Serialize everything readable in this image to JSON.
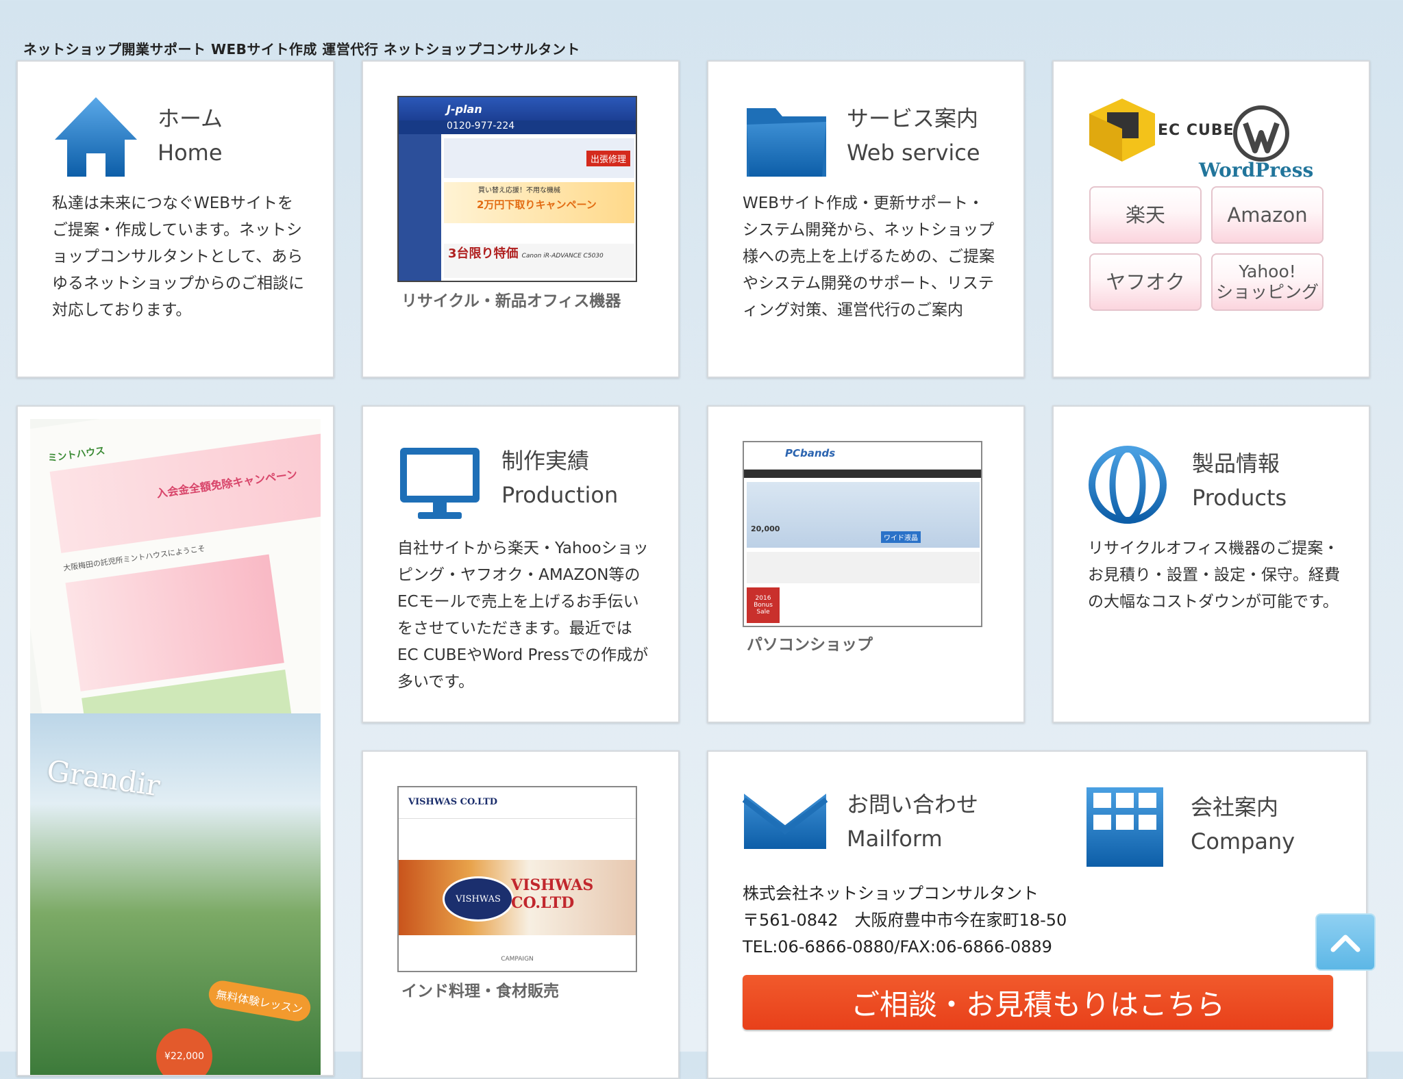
{
  "site_title": "ネットショップ開業サポート WEBサイト作成 運営代行 ネットショップコンサルタント",
  "home": {
    "title_ja": "ホーム",
    "title_en": "Home",
    "description": "私達は未来につなぐWEBサイトをご提案・作成しています。ネットショップコンサルタントとして、あらゆるネットショップからのご相談に対応しております。"
  },
  "recycle": {
    "caption": "リサイクル・新品オフィス機器",
    "shot_logo": "J-plan",
    "shot_phone": "0120-977-224",
    "shot_banner": "出張修理",
    "shot_sale": "2万円下取りキャンペーン",
    "shot_sub": "買い替え応援！不用な機械",
    "shot_deal": "3台限り特価",
    "shot_brand": "Canon iR-ADVANCE C5030"
  },
  "service": {
    "title_ja": "サービス案内",
    "title_en": "Web service",
    "description": "WEBサイト作成・更新サポート・システム開発から、ネットショップ様への売上を上げるための、ご提案やシステム開発のサポート、リスティング対策、運営代行のご案内"
  },
  "malls": {
    "eccube_label": "EC CUBE",
    "wordpress_label": "WordPress",
    "buttons": [
      "楽天",
      "Amazon",
      "ヤフオク",
      "Yahoo!\nショッピング"
    ]
  },
  "mint": {
    "brand": "ミントハウス",
    "welcome": "大阪梅田の託児所ミントハウスにようこそ",
    "campaign": "入会金全額免除キャンペーン",
    "grandir": "Grandir",
    "lesson": "無料体験レッスン",
    "price": "¥22,000"
  },
  "production": {
    "title_ja": "制作実績",
    "title_en": "Production",
    "description": "自社サイトから楽天・Yahooショッピング・ヤフオク・AMAZON等のECモールで売上を上げるお手伝いをさせていただきます。最近ではEC CUBEやWord Pressでの作成が多いです。"
  },
  "pcshop": {
    "caption": "パソコンショップ",
    "shot_logo": "PCbands",
    "shot_price": "20,000",
    "shot_sale": "2016 Bonus Sale",
    "shot_badge": "ワイド液晶"
  },
  "products": {
    "title_ja": "製品情報",
    "title_en": "Products",
    "description": "リサイクルオフィス機器のご提案・お見積り・設置・設定・保守。経費の大幅なコストダウンが可能です。"
  },
  "indian": {
    "caption": "インド料理・食材販売",
    "shot_brand": "VISHWAS CO.LTD",
    "shot_logo": "VISHWAS",
    "shot_footer": "CAMPAIGN"
  },
  "contact": {
    "title_ja": "お問い合わせ",
    "title_en": "Mailform",
    "company_title_ja": "会社案内",
    "company_title_en": "Company",
    "company_name": "株式会社ネットショップコンサルタント",
    "address": "〒561-0842　大阪府豊中市今在家町18-50",
    "tel_fax": "TEL:06-6866-0880/FAX:06-6866-0889",
    "cta_label": "ご相談・お見積もりはこちら"
  },
  "colors": {
    "icon_blue": "#1f73b7",
    "cta_orange": "#ea4a1f",
    "background": "#dfeaf2"
  }
}
